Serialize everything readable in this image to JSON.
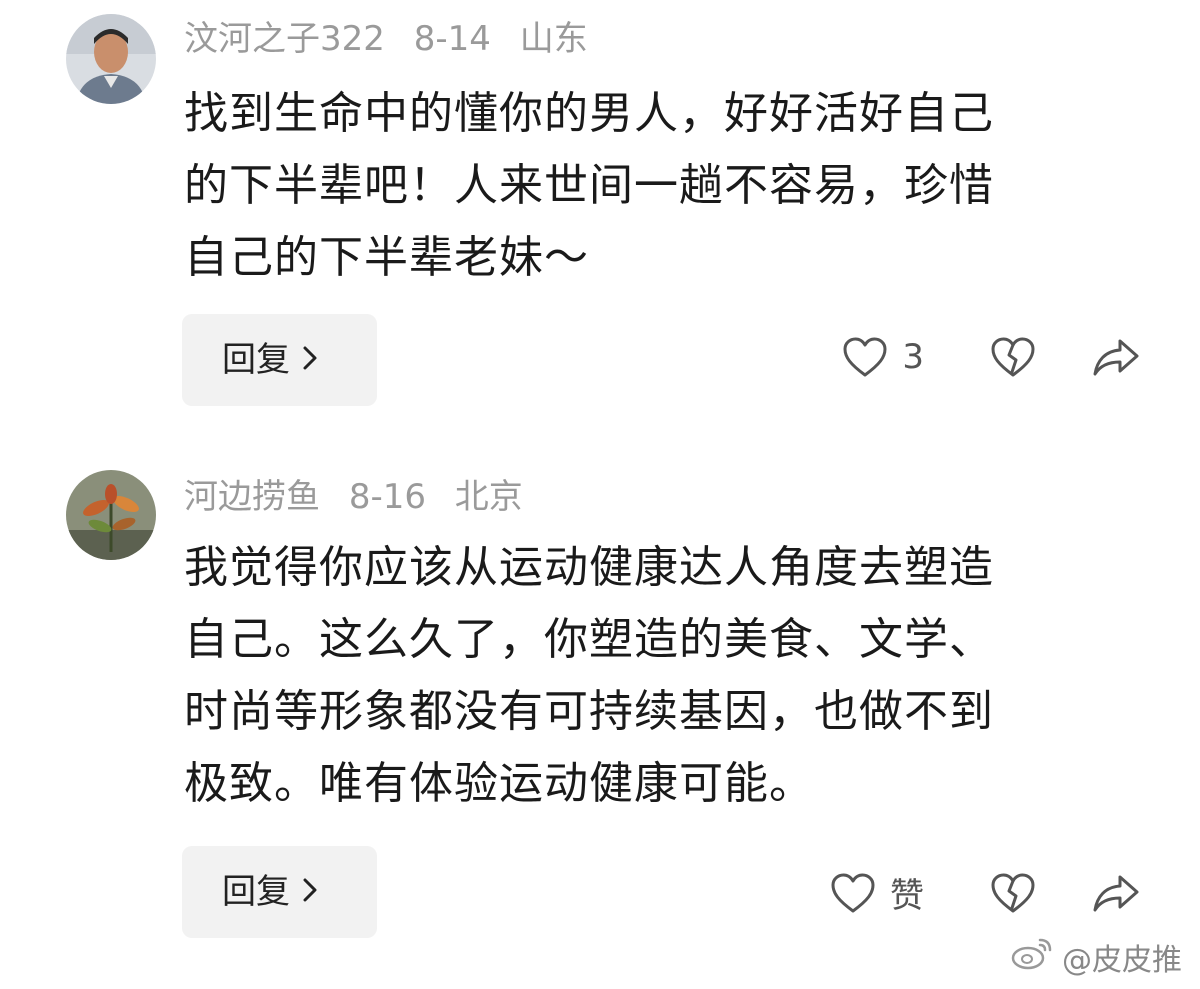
{
  "comments": [
    {
      "username": "汶河之子322",
      "date": "8-14",
      "location": "山东",
      "text_lines": [
        "找到生命中的懂你的男人，好好活好自己",
        "的下半辈吧！人来世间一趟不容易，珍惜",
        "自己的下半辈老妹～"
      ],
      "reply_label": "回复",
      "like_count": "3"
    },
    {
      "username": "河边捞鱼",
      "date": "8-16",
      "location": "北京",
      "text_lines": [
        "我觉得你应该从运动健康达人角度去塑造",
        "自己。这么久了，你塑造的美食、文学、",
        "时尚等形象都没有可持续基因，也做不到",
        "极致。唯有体验运动健康可能。"
      ],
      "reply_label": "回复",
      "like_count": "赞"
    }
  ],
  "watermark": "@皮皮推",
  "colors": {
    "meta": "#9a9a9a",
    "text": "#1a1a1a",
    "reply_bg": "#f2f2f2",
    "icon": "#555555"
  }
}
